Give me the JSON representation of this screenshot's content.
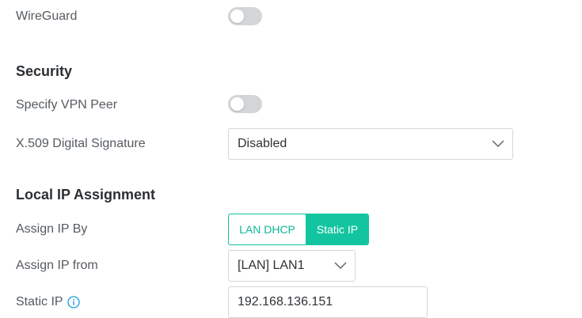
{
  "wireguard": {
    "label": "WireGuard",
    "enabled": false
  },
  "security": {
    "title": "Security",
    "specify_vpn_peer": {
      "label": "Specify VPN Peer",
      "enabled": false
    },
    "x509_signature": {
      "label": "X.509 Digital Signature",
      "value": "Disabled"
    }
  },
  "local_ip_assignment": {
    "title": "Local IP Assignment",
    "assign_ip_by": {
      "label": "Assign IP By",
      "options": [
        "LAN DHCP",
        "Static IP"
      ],
      "selected": "Static IP"
    },
    "assign_ip_from": {
      "label": "Assign IP from",
      "value": "[LAN] LAN1"
    },
    "static_ip": {
      "label": "Static IP",
      "value": "192.168.136.151",
      "info_icon": "info-icon"
    }
  },
  "colors": {
    "accent": "#12c5a0",
    "toggle_off": "#d3d6d9",
    "info_icon": "#1a9be0"
  }
}
